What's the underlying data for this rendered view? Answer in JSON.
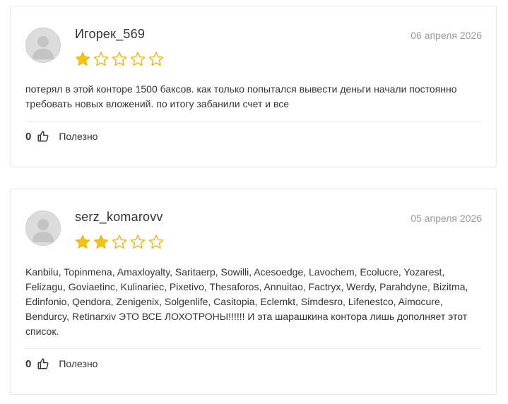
{
  "reviews": [
    {
      "username": "Игорек_569",
      "date": "06 апреля 2026",
      "rating": 1,
      "max_rating": 5,
      "text": "потерял в этой конторе 1500 баксов. как только попытался вывести деньги начали постоянно требовать новых вложений. по итогу забанили счет и все",
      "likes": "0",
      "helpful_label": "Полезно"
    },
    {
      "username": "serz_komarovv",
      "date": "05 апреля 2026",
      "rating": 2,
      "max_rating": 5,
      "text": "Kanbilu, Topinmena, Amaxloyalty, Saritaerp, Sowilli, Acesoedge, Lavochem, Ecolucre, Yozarest, Felizagu, Goviaetinc, Kulinariec, Pixetivo, Thesaforos, Annuitao, Factryx, Werdy, Parahdyne, Bizitma, Edinfonio, Qendora, Zenigenix, Solgenlife, Casitopia, Eclemkt, Simdesro, Lifenestco, Aimocure, Bendurcy, Retinarxiv ЭТО ВСЕ ЛОХОТРОНЫ!!!!!! И эта шарашкина контора лишь дополняет этот список.",
      "likes": "0",
      "helpful_label": "Полезно"
    }
  ],
  "icons": {
    "avatar": "user-avatar-icon",
    "star": "star-icon",
    "like": "thumbs-up-icon"
  },
  "colors": {
    "star_filled": "#f2c40f",
    "star_outline": "#e8b90d",
    "date": "#9a9a9a",
    "text": "#333333",
    "border": "#e6e6e6"
  }
}
